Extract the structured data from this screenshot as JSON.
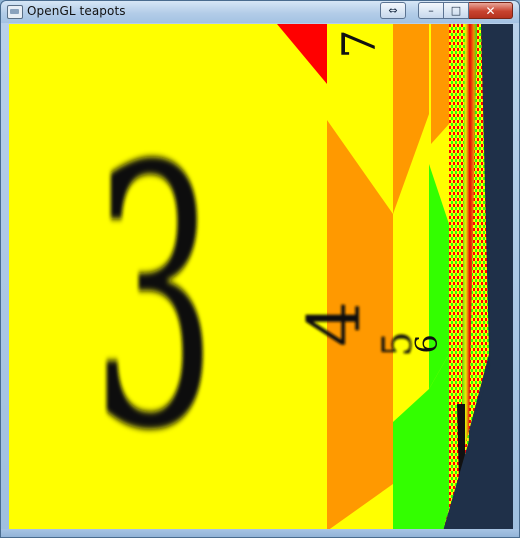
{
  "window": {
    "title": "OpenGL teapots",
    "restore_glyph": "⇔",
    "minimize_glyph": "–",
    "maximize_glyph": "□",
    "close_glyph": "✕"
  },
  "scene": {
    "digits": [
      "3",
      "4",
      "5",
      "6",
      "7"
    ],
    "colors": {
      "yellow": "#ffff00",
      "orange": "#ff9900",
      "red": "#ff0000",
      "green": "#33ff00",
      "background": "#1f3049"
    }
  }
}
